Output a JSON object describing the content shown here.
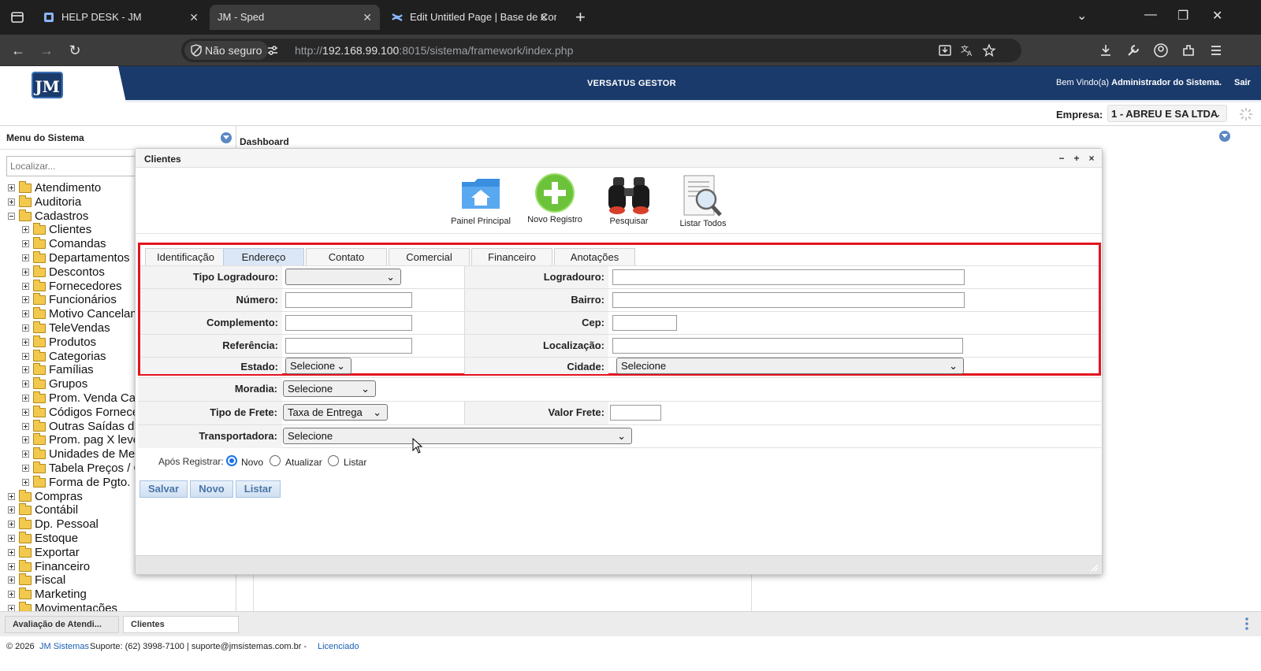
{
  "browser": {
    "tabs": [
      {
        "title": "HELP DESK - JM"
      },
      {
        "title": "JM - Sped"
      },
      {
        "title": "Edit Untitled Page | Base de Cor"
      }
    ],
    "security_label": "Não seguro",
    "url_prefix": "http://",
    "url_host": "192.168.99.100",
    "url_rest": ":8015/sistema/framework/index.php"
  },
  "app": {
    "logo_text": "JM",
    "title": "VERSATUS GESTOR",
    "welcome_prefix": "Bem Vindo(a)",
    "welcome_user": "Administrador do Sistema.",
    "logout": "Sair",
    "empresa_label": "Empresa:",
    "empresa_value": "1 - ABREU E SA LTDA"
  },
  "sidebar": {
    "title": "Menu do Sistema",
    "search_placeholder": "Localizar...",
    "items": [
      {
        "label": "Atendimento",
        "level": 0,
        "expanded": false
      },
      {
        "label": "Auditoria",
        "level": 0,
        "expanded": false
      },
      {
        "label": "Cadastros",
        "level": 0,
        "expanded": true
      },
      {
        "label": "Clientes",
        "level": 1,
        "expanded": false
      },
      {
        "label": "Comandas",
        "level": 1,
        "expanded": false
      },
      {
        "label": "Departamentos",
        "level": 1,
        "expanded": false
      },
      {
        "label": "Descontos",
        "level": 1,
        "expanded": false
      },
      {
        "label": "Fornecedores",
        "level": 1,
        "expanded": false
      },
      {
        "label": "Funcionários",
        "level": 1,
        "expanded": false
      },
      {
        "label": "Motivo Cancelam",
        "level": 1,
        "expanded": false
      },
      {
        "label": "TeleVendas",
        "level": 1,
        "expanded": false
      },
      {
        "label": "Produtos",
        "level": 1,
        "expanded": false
      },
      {
        "label": "Categorias",
        "level": 1,
        "expanded": false
      },
      {
        "label": "Famílias",
        "level": 1,
        "expanded": false
      },
      {
        "label": "Grupos",
        "level": 1,
        "expanded": false
      },
      {
        "label": "Prom. Venda Ca",
        "level": 1,
        "expanded": false
      },
      {
        "label": "Códigos Fornece",
        "level": 1,
        "expanded": false
      },
      {
        "label": "Outras Saídas d",
        "level": 1,
        "expanded": false
      },
      {
        "label": "Prom. pag X leve",
        "level": 1,
        "expanded": false
      },
      {
        "label": "Unidades de Me",
        "level": 1,
        "expanded": false
      },
      {
        "label": "Tabela Preços / C",
        "level": 1,
        "expanded": false
      },
      {
        "label": "Forma de Pgto.",
        "level": 1,
        "expanded": false
      },
      {
        "label": "Compras",
        "level": 0,
        "expanded": false
      },
      {
        "label": "Contábil",
        "level": 0,
        "expanded": false
      },
      {
        "label": "Dp. Pessoal",
        "level": 0,
        "expanded": false
      },
      {
        "label": "Estoque",
        "level": 0,
        "expanded": false
      },
      {
        "label": "Exportar",
        "level": 0,
        "expanded": false
      },
      {
        "label": "Financeiro",
        "level": 0,
        "expanded": false
      },
      {
        "label": "Fiscal",
        "level": 0,
        "expanded": false
      },
      {
        "label": "Marketing",
        "level": 0,
        "expanded": false
      },
      {
        "label": "Movimentações",
        "level": 0,
        "expanded": false
      }
    ]
  },
  "dashboard": {
    "title": "Dashboard"
  },
  "modal": {
    "title": "Clientes",
    "toolbar": {
      "painel": "Painel Principal",
      "novo": "Novo Registro",
      "pesquisar": "Pesquisar",
      "listar": "Listar Todos"
    },
    "tabs": [
      "Identificação",
      "Endereço",
      "Contato",
      "Comercial",
      "Financeiro",
      "Anotações"
    ],
    "active_tab": "Endereço",
    "fields": {
      "tipo_logradouro": {
        "label": "Tipo Logradouro:",
        "value": ""
      },
      "logradouro": {
        "label": "Logradouro:",
        "value": ""
      },
      "numero": {
        "label": "Número:",
        "value": ""
      },
      "bairro": {
        "label": "Bairro:",
        "value": ""
      },
      "complemento": {
        "label": "Complemento:",
        "value": ""
      },
      "cep": {
        "label": "Cep:",
        "value": ""
      },
      "referencia": {
        "label": "Referência:",
        "value": ""
      },
      "localizacao": {
        "label": "Localização:",
        "value": ""
      },
      "estado": {
        "label": "Estado:",
        "value": "Selecione"
      },
      "cidade": {
        "label": "Cidade:",
        "value": "Selecione"
      },
      "moradia": {
        "label": "Moradia:",
        "value": "Selecione"
      },
      "tipo_frete": {
        "label": "Tipo de Frete:",
        "value": "Taxa de Entrega"
      },
      "valor_frete": {
        "label": "Valor Frete:",
        "value": ""
      },
      "transportadora": {
        "label": "Transportadora:",
        "value": "Selecione"
      }
    },
    "apos_registrar": {
      "label": "Após Registrar:",
      "options": [
        "Novo",
        "Atualizar",
        "Listar"
      ],
      "selected": "Novo"
    },
    "buttons": {
      "salvar": "Salvar",
      "novo": "Novo",
      "listar": "Listar"
    }
  },
  "taskbar": {
    "tabs": [
      "Avaliação de Atendi...",
      "Clientes"
    ]
  },
  "footer": {
    "copyright": "© 2026",
    "company": "JM Sistemas",
    "support": "Suporte: (62) 3998-7100 | suporte@jmsistemas.com.br -",
    "license": "Licenciado"
  },
  "colors": {
    "header_bg": "#1a3a6b",
    "highlight_border": "#e3141f",
    "active_tab": "#dbe7f6",
    "radio_on": "#1a73e8"
  }
}
